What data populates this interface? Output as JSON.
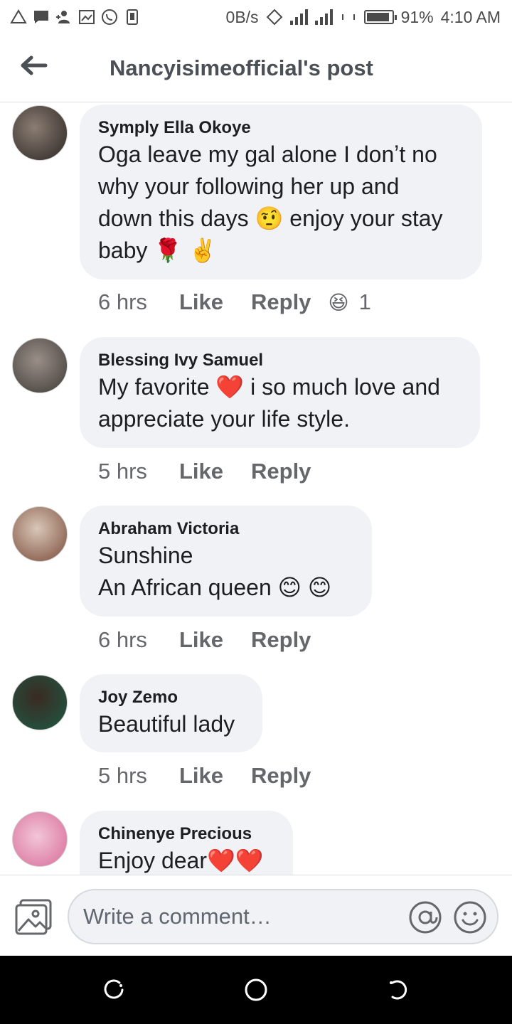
{
  "status_bar": {
    "net_speed": "0B/s",
    "battery_percent": "91%",
    "battery_level": 0.91,
    "time": "4:10 AM",
    "icons": [
      "warning-icon",
      "message-icon",
      "add-person-icon",
      "image-icon",
      "whatsapp-icon",
      "sim-icon",
      "rotate-icon",
      "signal-icon",
      "signal-icon",
      "vibrate-icon",
      "battery-icon"
    ]
  },
  "header": {
    "title": "Nancyisimeofficial's post",
    "back_icon": "arrow-left-icon"
  },
  "comments": [
    {
      "author": "Symply Ella Okoye",
      "text": "Oga leave my gal alone I donʼt no\nwhy your following her up and\ndown this days 🤨 enjoy your stay\nbaby 🌹 ✌️",
      "time": "6 hrs",
      "like": "Like",
      "reply": "Reply",
      "reaction_emoji": "😆",
      "reaction_count": "1",
      "avatar_colors": [
        "#6b5e55",
        "#2a2523"
      ]
    },
    {
      "author": "Blessing Ivy Samuel",
      "text": "My favorite ❤️ i so much love and\nappreciate your life style.",
      "time": "5 hrs",
      "like": "Like",
      "reply": "Reply",
      "avatar_colors": [
        "#8a8079",
        "#3e3a36"
      ]
    },
    {
      "author": "Abraham Victoria",
      "text": "Sunshine\nAn African queen 😊 😊",
      "time": "6 hrs",
      "like": "Like",
      "reply": "Reply",
      "avatar_colors": [
        "#d9c7b8",
        "#7a4a38"
      ]
    },
    {
      "author": "Joy Zemo",
      "text": "Beautiful lady",
      "time": "5 hrs",
      "like": "Like",
      "reply": "Reply",
      "avatar_colors": [
        "#1d5a45",
        "#3a2a22"
      ]
    },
    {
      "author": "Chinenye Precious",
      "text": "Enjoy dear❤️❤️",
      "avatar_colors": [
        "#f2c6d6",
        "#d86a9a"
      ]
    }
  ],
  "composer": {
    "placeholder": "Write a comment…",
    "photo_icon": "photo-icon",
    "mention_icon": "at-sign-icon",
    "emoji_icon": "smiley-icon"
  },
  "navbar": {
    "icons": [
      "recent-apps-icon",
      "home-icon",
      "back-icon"
    ]
  },
  "colors": {
    "bubble": "#f0f2f5",
    "meta_text": "#65676b",
    "header_text": "#4b4f56",
    "navbar": "#000000"
  }
}
